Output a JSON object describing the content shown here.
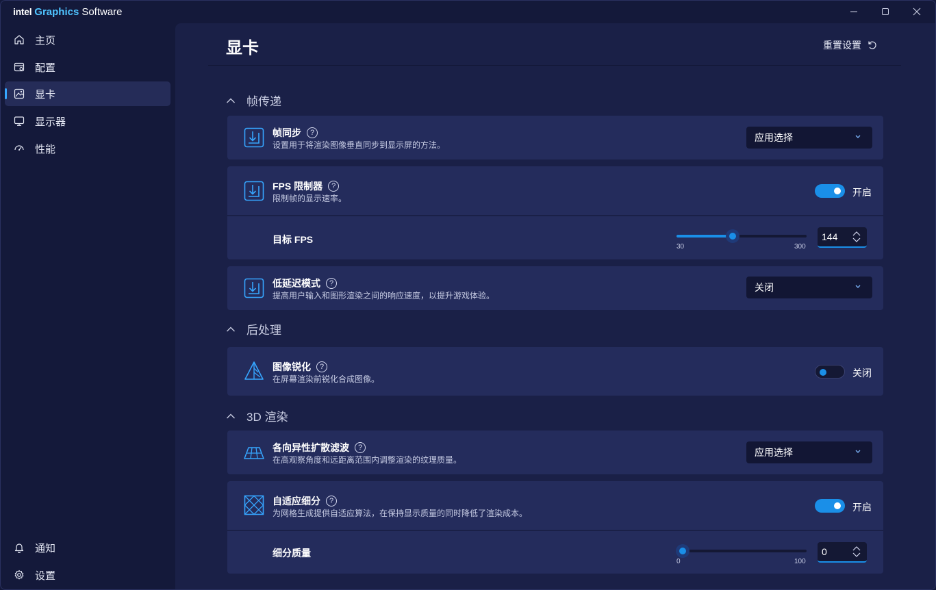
{
  "app": {
    "brand_intel": "intel",
    "brand_graphics": "Graphics",
    "brand_software": "Software"
  },
  "sidebar": {
    "items": [
      {
        "label": "主页",
        "icon": "home-icon"
      },
      {
        "label": "配置",
        "icon": "profile-icon"
      },
      {
        "label": "显卡",
        "icon": "graphics-icon",
        "active": true
      },
      {
        "label": "显示器",
        "icon": "monitor-icon"
      },
      {
        "label": "性能",
        "icon": "performance-icon"
      }
    ],
    "bottom_items": [
      {
        "label": "通知",
        "icon": "bell-icon"
      },
      {
        "label": "设置",
        "icon": "gear-icon"
      }
    ]
  },
  "header": {
    "title": "显卡",
    "reset_label": "重置设置"
  },
  "sections": {
    "frame_delivery": {
      "title": "帧传递",
      "vsync": {
        "title": "帧同步",
        "desc": "设置用于将渲染图像垂直同步到显示屏的方法。",
        "value": "应用选择"
      },
      "fps_limiter": {
        "title": "FPS 限制器",
        "desc": "限制帧的显示速率。",
        "state": "开启",
        "on": true
      },
      "target_fps": {
        "label": "目标 FPS",
        "min": "30",
        "max": "300",
        "value": "144"
      },
      "low_latency": {
        "title": "低延迟模式",
        "desc": "提高用户输入和图形渲染之间的响应速度，以提升游戏体验。",
        "value": "关闭"
      }
    },
    "post_processing": {
      "title": "后处理",
      "sharpening": {
        "title": "图像锐化",
        "desc": "在屏幕渲染前锐化合成图像。",
        "state": "关闭",
        "on": false
      }
    },
    "rendering_3d": {
      "title": "3D 渲染",
      "anisotropic": {
        "title": "各向异性扩散滤波",
        "desc": "在高观察角度和远距离范围内调整渲染的纹理质量。",
        "value": "应用选择"
      },
      "tessellation": {
        "title": "自适应细分",
        "desc": "为网格生成提供自适应算法，在保持显示质量的同时降低了渲染成本。",
        "state": "开启",
        "on": true
      },
      "tess_quality": {
        "label": "细分质量",
        "min": "0",
        "max": "100",
        "value": "0"
      }
    }
  },
  "colors": {
    "accent": "#1a8fe8",
    "background": "#14193a",
    "card": "#242c5c",
    "brand": "#4fc3ff"
  }
}
